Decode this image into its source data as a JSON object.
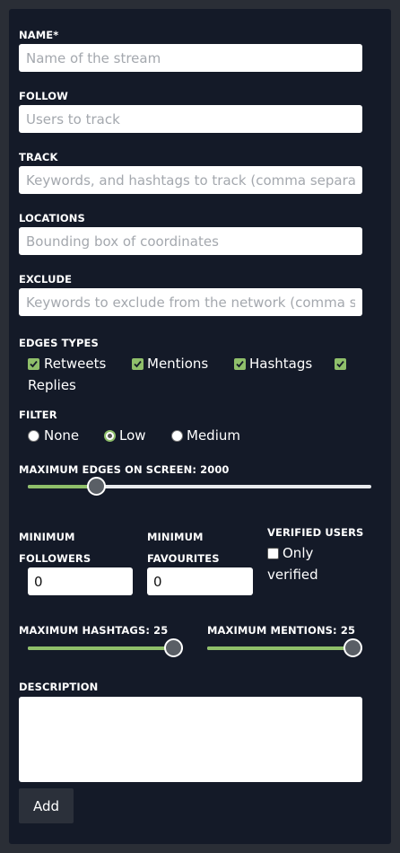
{
  "form": {
    "name": {
      "label": "NAME*",
      "placeholder": "Name of the stream"
    },
    "follow": {
      "label": "FOLLOW",
      "placeholder": "Users to track"
    },
    "track": {
      "label": "TRACK",
      "placeholder": "Keywords, and hashtags to track (comma separated)"
    },
    "locations": {
      "label": "LOCATIONS",
      "placeholder": "Bounding box of coordinates"
    },
    "exclude": {
      "label": "EXCLUDE",
      "placeholder": "Keywords to exclude from the network (comma separated)"
    },
    "edge_types": {
      "label": "EDGES TYPES",
      "options": [
        {
          "label": "Retweets",
          "checked": true
        },
        {
          "label": "Mentions",
          "checked": true
        },
        {
          "label": "Hashtags",
          "checked": true
        },
        {
          "label": "Replies",
          "checked": true
        }
      ]
    },
    "filter": {
      "label": "FILTER",
      "options": [
        "None",
        "Low",
        "Medium"
      ],
      "selected": "Low"
    },
    "max_edges": {
      "label": "MAXIMUM EDGES ON SCREEN: 2000",
      "value": 2000,
      "fraction": 0.2
    },
    "min_followers": {
      "label_line1": "MINIMUM",
      "label_line2": "FOLLOWERS",
      "value": "0"
    },
    "min_favourites": {
      "label_line1": "MINIMUM",
      "label_line2": "FAVOURITES",
      "value": "0"
    },
    "verified": {
      "label": "VERIFIED USERS",
      "option_line1": "Only",
      "option_line2": "verified",
      "checked": false
    },
    "max_hashtags": {
      "label": "MAXIMUM HASHTAGS: 25",
      "value": 25,
      "fraction": 1.0
    },
    "max_mentions": {
      "label": "MAXIMUM MENTIONS: 25",
      "value": 25,
      "fraction": 1.0
    },
    "description": {
      "label": "DESCRIPTION",
      "value": ""
    },
    "submit_label": "Add"
  },
  "colors": {
    "panel": "#141a28",
    "accent": "#8fbf6a",
    "page": "#2a2e36"
  },
  "icons": {
    "checkbox_check": "check-icon"
  }
}
